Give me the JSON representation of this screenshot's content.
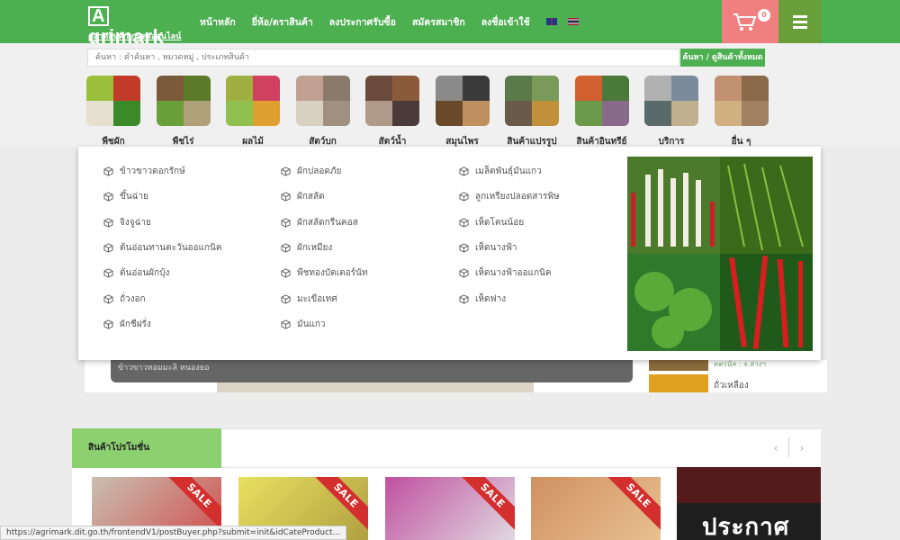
{
  "header": {
    "logo_main": "grimark",
    "logo_letter": "A",
    "logo_sub": "ตลาดสินค้าเกษตรออนไลน์",
    "nav": [
      "หน้าหลัก",
      "ยี่ห้อ/ตราสินค้า",
      "ลงประกาศรับซื้อ",
      "สมัครสมาชิก",
      "ลงชื่อเข้าใช้"
    ],
    "cart_count": "0"
  },
  "search": {
    "placeholder": "ค้นหา : คำค้นหา , หมวดหมู่ , ประเภทสินค้า",
    "button": "ค้นหา / ดูสินค้าทั้งหมด"
  },
  "categories": [
    {
      "label": "พืชผัก",
      "colors": [
        "#9bbf3a",
        "#c23a2a",
        "#e6e0d0",
        "#3a8a2a"
      ]
    },
    {
      "label": "พืชไร่",
      "colors": [
        "#7a5a3a",
        "#5a7a2a",
        "#6aa03a",
        "#b0a07a"
      ]
    },
    {
      "label": "ผลไม้",
      "colors": [
        "#a0b040",
        "#d04060",
        "#90c050",
        "#e0a030"
      ]
    },
    {
      "label": "สัตว์บก",
      "colors": [
        "#c0a090",
        "#8a7a6a",
        "#d8d0c0",
        "#a09080"
      ]
    },
    {
      "label": "สัตว์น้ำ",
      "colors": [
        "#6a4a3a",
        "#8a5a3a",
        "#b09a8a",
        "#4a3a3a"
      ]
    },
    {
      "label": "สมุนไพร",
      "colors": [
        "#8a8a8a",
        "#3a3a3a",
        "#6a4a2a",
        "#c09060"
      ]
    },
    {
      "label": "สินค้าแปรรูป",
      "colors": [
        "#5a7a4a",
        "#7a9a5a",
        "#6a5a4a",
        "#c0903a"
      ]
    },
    {
      "label": "สินค้าอินทรีย์",
      "colors": [
        "#d06030",
        "#4a7a3a",
        "#6a9a4a",
        "#8a6a8a"
      ]
    },
    {
      "label": "บริการ",
      "colors": [
        "#b0b0b0",
        "#7a8a9a",
        "#5a6a6a",
        "#c0b090"
      ]
    },
    {
      "label": "อื่น ๆ",
      "colors": [
        "#c09070",
        "#8a6a4a",
        "#d0b080",
        "#a08060"
      ]
    }
  ],
  "submenu": {
    "col1": [
      "ข้าวขาวดอกรักษ์",
      "ขึ้นฉ่าย",
      "จิงจูฉ่าย",
      "ต้นอ่อนทานตะวันออแกนิค",
      "ต้นอ่อนผักบุ้ง",
      "ถั่วงอก",
      "ผักชีฝรั่ง"
    ],
    "col2": [
      "ผักปลอดภัย",
      "ผักสลัด",
      "ผักสลัดกรีนคอส",
      "ผักเหมียง",
      "พืชทองบัตเตอร์นัท",
      "มะเขือเทศ",
      "มันแกว"
    ],
    "col3": [
      "เมล็ดพันธุ์มันแกว",
      "ลูกเหรียงปลอดสารพิษ",
      "เห็ดโคนน้อย",
      "เห็ดนางฟ้า",
      "เห็ดนางฟ้าออแกนิค",
      "เห็ดฟาง"
    ]
  },
  "underlay": {
    "slider_caption": "ข้าวขาวหอมมะลิ หนองยอ",
    "side_item1": "ฅตรนัล  : จ.ล่างฯ",
    "side_item2": "ถั่วเหลือง"
  },
  "promo": {
    "title": "สินค้าโปรโมชั่น",
    "prev": "‹",
    "next": "›",
    "sale_label": "SALE",
    "products": [
      {
        "colors": [
          "#c8c0b0",
          "#d05050"
        ]
      },
      {
        "colors": [
          "#e8e060",
          "#b0a040"
        ]
      },
      {
        "colors": [
          "#c050a0",
          "#e0d8e0"
        ]
      },
      {
        "colors": [
          "#d09060",
          "#e8c090"
        ]
      }
    ],
    "announce": "ประกาศ"
  },
  "status_url": "https://agrimark.dit.go.th/frontendV1/postBuyer.php?submit=init&idCateProduct..."
}
